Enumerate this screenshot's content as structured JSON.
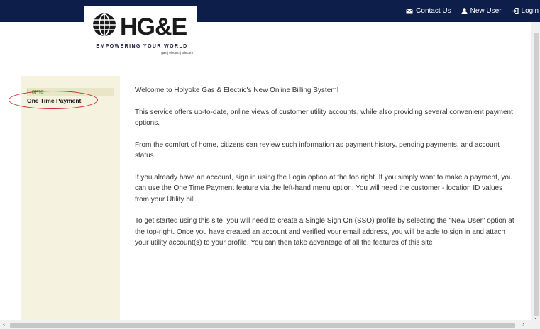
{
  "header": {
    "links": [
      {
        "label": "Contact Us",
        "icon": "envelope-icon"
      },
      {
        "label": "New User",
        "icon": "user-icon"
      },
      {
        "label": "Login",
        "icon": "sign-in-icon"
      }
    ]
  },
  "logo": {
    "name": "HG&E",
    "tagline": "EMPOWERING YOUR WORLD",
    "subline": "gas | electric | telecom"
  },
  "sidebar": {
    "items": [
      {
        "label": "Home"
      },
      {
        "label": "One Time Payment"
      }
    ]
  },
  "main": {
    "paragraphs": [
      "Welcome to Holyoke Gas & Electric's New Online Billing System!",
      "This service offers up-to-date, online views of customer utility accounts, while also providing several convenient payment options.",
      "From the comfort of home, citizens can review such information as payment history, pending payments, and account status.",
      "If you already have an account, sign in using the Login option at the top right. If you simply want to make a payment, you can use the One Time Payment feature via the left-hand menu option. You will need the customer - location ID values from your Utility bill.",
      "To get started using this site, you will need to create a Single Sign On (SSO) profile by selecting the \"New User\" option at the top-right. Once you have created an account and verified your email address, you will be able to sign in and attach your utility account(s) to your profile. You can then take advantage of all the features of this site"
    ]
  },
  "colors": {
    "topbar": "#0e1e4a",
    "sidebar": "#f5f2df",
    "home_link": "#6c8f2a",
    "annotation": "#c8232c"
  }
}
